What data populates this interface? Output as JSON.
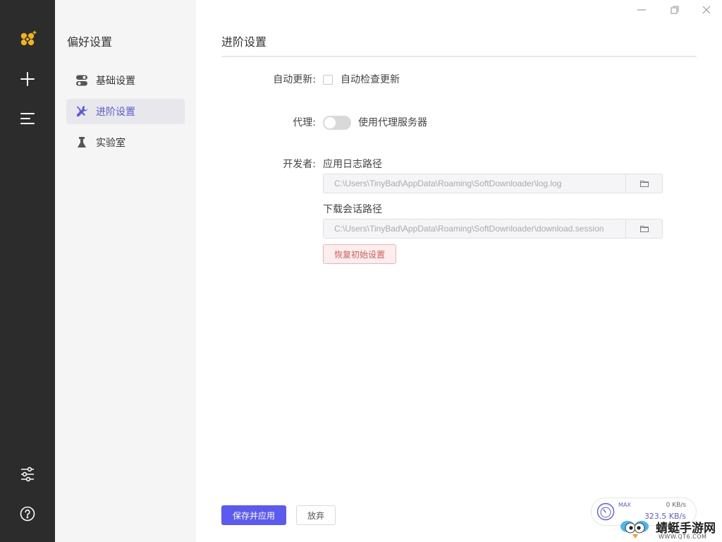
{
  "rail": {
    "icons": [
      "app-logo-icon",
      "add-icon",
      "task-list-icon",
      "preferences-icon",
      "help-icon"
    ]
  },
  "sidebar": {
    "title": "偏好设置",
    "items": [
      {
        "label": "基础设置",
        "icon": "toggle-switch-icon",
        "active": false
      },
      {
        "label": "进阶设置",
        "icon": "tools-icon",
        "active": true
      },
      {
        "label": "实验室",
        "icon": "flask-icon",
        "active": false
      }
    ]
  },
  "window": {
    "controls": [
      "minimize-icon",
      "maximize-icon",
      "close-icon"
    ]
  },
  "main": {
    "title": "进阶设置",
    "auto_update": {
      "label": "自动更新:",
      "checkbox_label": "自动检查更新",
      "checked": false
    },
    "proxy": {
      "label": "代理:",
      "toggle_label": "使用代理服务器",
      "enabled": false
    },
    "developer": {
      "label": "开发者:",
      "log_path_label": "应用日志路径",
      "log_path_value": "C:\\Users\\TinyBad\\AppData\\Roaming\\SoftDownloader\\log.log",
      "session_path_label": "下载会话路径",
      "session_path_value": "C:\\Users\\TinyBad\\AppData\\Roaming\\SoftDownloader\\download.session",
      "reset_button": "恢复初始设置"
    }
  },
  "footer": {
    "save_button": "保存并应用",
    "discard_button": "放弃"
  },
  "speed": {
    "max_label": "MAX",
    "upload": "0 KB/s",
    "download": "323.5 KB/s"
  },
  "watermark": {
    "brand": "蜻蜓手游网",
    "url": "WWW.QT6.COM"
  },
  "colors": {
    "accent": "#5b5bf0",
    "rail_bg": "#2c2c2c",
    "side_bg": "#f5f5f5",
    "danger": "#e05a5a"
  }
}
